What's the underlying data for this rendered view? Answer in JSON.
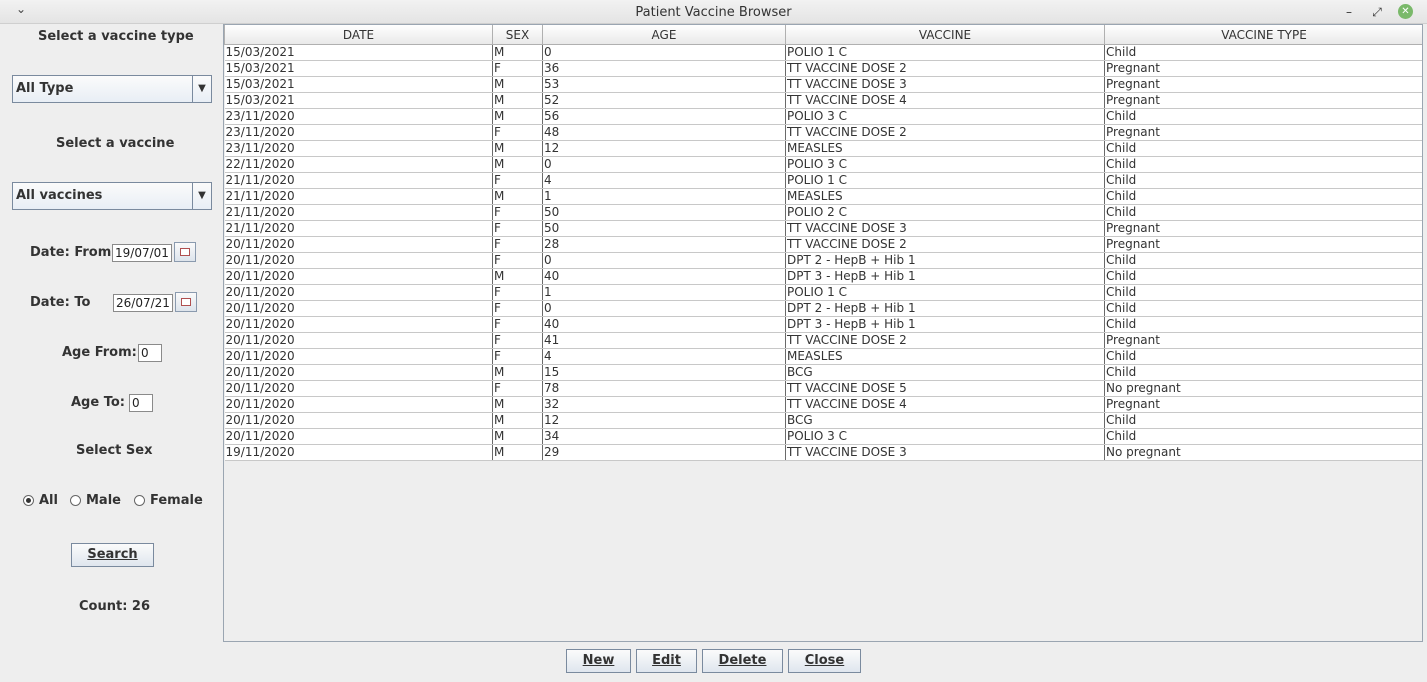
{
  "window": {
    "title": "Patient Vaccine Browser"
  },
  "filters": {
    "vaccine_type_label": "Select a vaccine type",
    "vaccine_type_value": "All Type",
    "vaccine_label": "Select a vaccine",
    "vaccine_value": "All vaccines",
    "date_from_label": "Date: From",
    "date_from_value": "19/07/01",
    "date_to_label": "Date: To",
    "date_to_value": "26/07/21",
    "age_from_label": "Age From:",
    "age_from_value": "0",
    "age_to_label": "Age To:",
    "age_to_value": "0",
    "sex_label": "Select Sex",
    "sex_options": [
      "All",
      "Male",
      "Female"
    ],
    "sex_selected": "All",
    "search_label": "Search",
    "count_text": "Count: 26"
  },
  "table": {
    "columns": [
      "DATE",
      "SEX",
      "AGE",
      "VACCINE",
      "VACCINE TYPE"
    ],
    "rows": [
      [
        "15/03/2021",
        "M",
        "0",
        "POLIO 1 C",
        "Child"
      ],
      [
        "15/03/2021",
        "F",
        "36",
        "TT VACCINE DOSE 2",
        "Pregnant"
      ],
      [
        "15/03/2021",
        "M",
        "53",
        "TT VACCINE DOSE 3",
        "Pregnant"
      ],
      [
        "15/03/2021",
        "M",
        "52",
        "TT VACCINE DOSE 4",
        "Pregnant"
      ],
      [
        "23/11/2020",
        "M",
        "56",
        "POLIO 3 C",
        "Child"
      ],
      [
        "23/11/2020",
        "F",
        "48",
        "TT VACCINE DOSE 2",
        "Pregnant"
      ],
      [
        "23/11/2020",
        "M",
        "12",
        "MEASLES",
        "Child"
      ],
      [
        "22/11/2020",
        "M",
        "0",
        "POLIO 3 C",
        "Child"
      ],
      [
        "21/11/2020",
        "F",
        "4",
        "POLIO 1 C",
        "Child"
      ],
      [
        "21/11/2020",
        "M",
        "1",
        "MEASLES",
        "Child"
      ],
      [
        "21/11/2020",
        "F",
        "50",
        "POLIO 2 C",
        "Child"
      ],
      [
        "21/11/2020",
        "F",
        "50",
        "TT VACCINE DOSE 3",
        "Pregnant"
      ],
      [
        "20/11/2020",
        "F",
        "28",
        "TT VACCINE DOSE 2",
        "Pregnant"
      ],
      [
        "20/11/2020",
        "F",
        "0",
        "DPT 2 - HepB + Hib 1",
        "Child"
      ],
      [
        "20/11/2020",
        "M",
        "40",
        "DPT 3 - HepB + Hib 1",
        "Child"
      ],
      [
        "20/11/2020",
        "F",
        "1",
        "POLIO 1 C",
        "Child"
      ],
      [
        "20/11/2020",
        "F",
        "0",
        "DPT 2 - HepB + Hib 1",
        "Child"
      ],
      [
        "20/11/2020",
        "F",
        "40",
        "DPT 3 - HepB + Hib 1",
        "Child"
      ],
      [
        "20/11/2020",
        "F",
        "41",
        "TT VACCINE DOSE 2",
        "Pregnant"
      ],
      [
        "20/11/2020",
        "F",
        "4",
        "MEASLES",
        "Child"
      ],
      [
        "20/11/2020",
        "M",
        "15",
        "BCG",
        "Child"
      ],
      [
        "20/11/2020",
        "F",
        "78",
        "TT VACCINE DOSE 5",
        "No pregnant"
      ],
      [
        "20/11/2020",
        "M",
        "32",
        "TT VACCINE DOSE 4",
        "Pregnant"
      ],
      [
        "20/11/2020",
        "M",
        "12",
        "BCG",
        "Child"
      ],
      [
        "20/11/2020",
        "M",
        "34",
        "POLIO 3 C",
        "Child"
      ],
      [
        "19/11/2020",
        "M",
        "29",
        "TT VACCINE DOSE 3",
        "No pregnant"
      ]
    ]
  },
  "actions": {
    "new_label": "New",
    "edit_label": "Edit",
    "delete_label": "Delete",
    "close_label": "Close"
  },
  "icons": {
    "window_menu": "chevron-down-icon",
    "minimize": "minimize-icon",
    "maximize": "maximize-icon",
    "close": "close-icon",
    "calendar": "calendar-icon"
  },
  "colors": {
    "close_button": "#7ab96a",
    "window_bg": "#eeeeee"
  }
}
